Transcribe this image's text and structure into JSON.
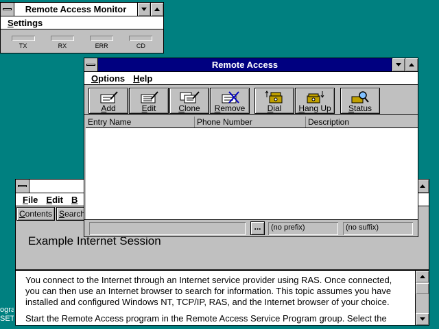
{
  "desktop": {
    "background": "#008080",
    "fragment_line1": "ogra",
    "fragment_line2": "SET"
  },
  "monitor": {
    "title": "Remote Access Monitor",
    "menu": [
      "Settings"
    ],
    "indicators": [
      "TX",
      "RX",
      "ERR",
      "CD"
    ]
  },
  "remote_access": {
    "title": "Remote Access",
    "title_color": "#000080",
    "menu": [
      "Options",
      "Help"
    ],
    "toolbar": [
      {
        "label": "Add",
        "icon": "add-entry-icon"
      },
      {
        "label": "Edit",
        "icon": "edit-entry-icon"
      },
      {
        "label": "Clone",
        "icon": "clone-entry-icon"
      },
      {
        "label": "Remove",
        "icon": "remove-entry-icon"
      },
      {
        "label": "Dial",
        "icon": "dial-phone-icon"
      },
      {
        "label": "Hang Up",
        "icon": "hang-up-phone-icon"
      },
      {
        "label": "Status",
        "icon": "status-magnifier-icon"
      }
    ],
    "columns": [
      "Entry Name",
      "Phone Number",
      "Description"
    ],
    "status": {
      "browse": "...",
      "prefix": "(no prefix)",
      "suffix": "(no suffix)"
    }
  },
  "help": {
    "menu": [
      "File",
      "Edit",
      "B"
    ],
    "tabs": [
      "Contents",
      "Search"
    ],
    "topic_title": "Example Internet Session",
    "paragraphs": [
      "You connect to the Internet through an Internet service provider using RAS. Once connected, you can then use an Internet browser to search for information. This topic assumes you have installed and configured Windows NT, TCP/IP, RAS, and the Internet browser of your choice.",
      "Start the Remote Access program in the Remote Access Service Program group. Select the"
    ]
  }
}
